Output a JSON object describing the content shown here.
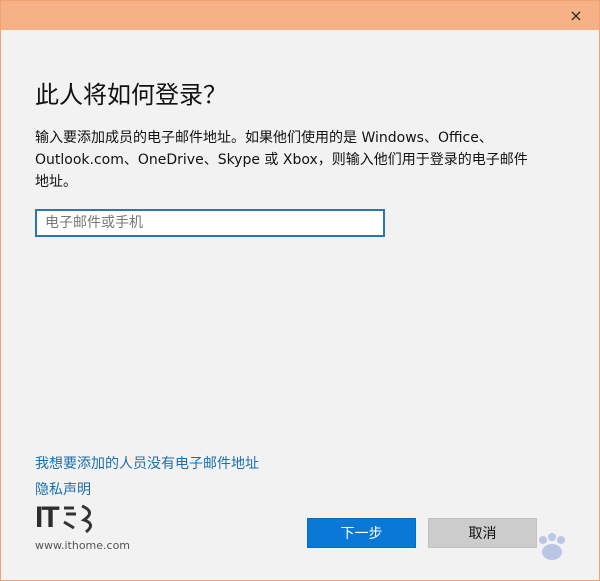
{
  "window": {
    "close_glyph": "×"
  },
  "dialog": {
    "title": "此人将如何登录？",
    "description": "输入要添加成员的电子邮件地址。如果他们使用的是 Windows、Office、Outlook.com、OneDrive、Skype 或 Xbox，则输入他们用于登录的电子邮件地址。",
    "input_placeholder": "电子邮件或手机",
    "input_value": ""
  },
  "links": {
    "no_email": "我想要添加的人员没有电子邮件地址",
    "privacy": "隐私声明"
  },
  "buttons": {
    "next": "下一步",
    "cancel": "取消"
  },
  "branding": {
    "logo_text": "IT",
    "logo_url_text": "www.ithome.com"
  },
  "colors": {
    "titlebar": "#f7b186",
    "primary_button": "#0a78d7",
    "link": "#1a6fb0"
  }
}
